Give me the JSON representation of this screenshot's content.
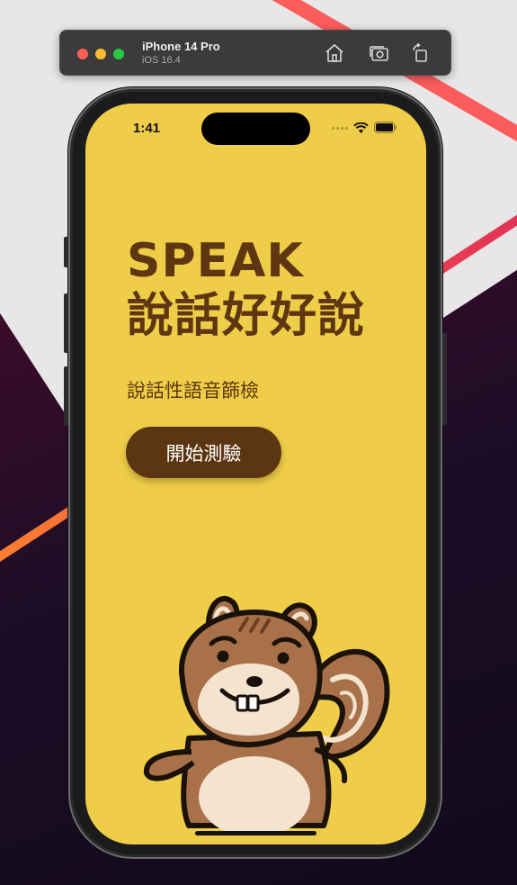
{
  "simulator": {
    "device_name": "iPhone 14 Pro",
    "os_version": "iOS 16.4",
    "icons": [
      "home-icon",
      "screenshot-icon",
      "rotate-icon"
    ]
  },
  "status_bar": {
    "time": "1:41",
    "icons": [
      "cellular-signal-icon",
      "wifi-icon",
      "battery-icon"
    ]
  },
  "app": {
    "title_line1": "SPEAK",
    "title_line2": "說話好好說",
    "subtitle": "說話性語音篩檢",
    "start_button": "開始測驗",
    "mascot": "squirrel-illustration"
  },
  "colors": {
    "background": "#f0cd48",
    "text_brown": "#5e3611",
    "button_brown": "#5c3612",
    "button_text": "#ffffff"
  }
}
